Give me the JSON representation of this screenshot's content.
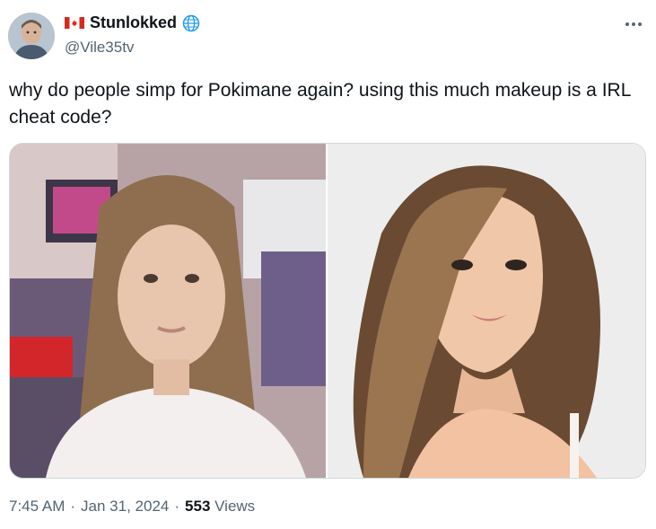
{
  "author": {
    "display_name": "Stunlokked",
    "handle": "@Vile35tv",
    "flag": "canada-flag-icon",
    "badge": "globe-icon"
  },
  "tweet": {
    "text": "why do people simp for Pokimane again? using this much makeup is a IRL cheat code?",
    "time": "7:45 AM",
    "date": "Jan 31, 2024",
    "separator": "·",
    "views_count": "553",
    "views_label": "Views"
  },
  "colors": {
    "text": "#0f1419",
    "muted": "#536471",
    "border": "#cfd9de",
    "flag_red": "#d52b1e",
    "globe_blue": "#1d9bf0"
  }
}
